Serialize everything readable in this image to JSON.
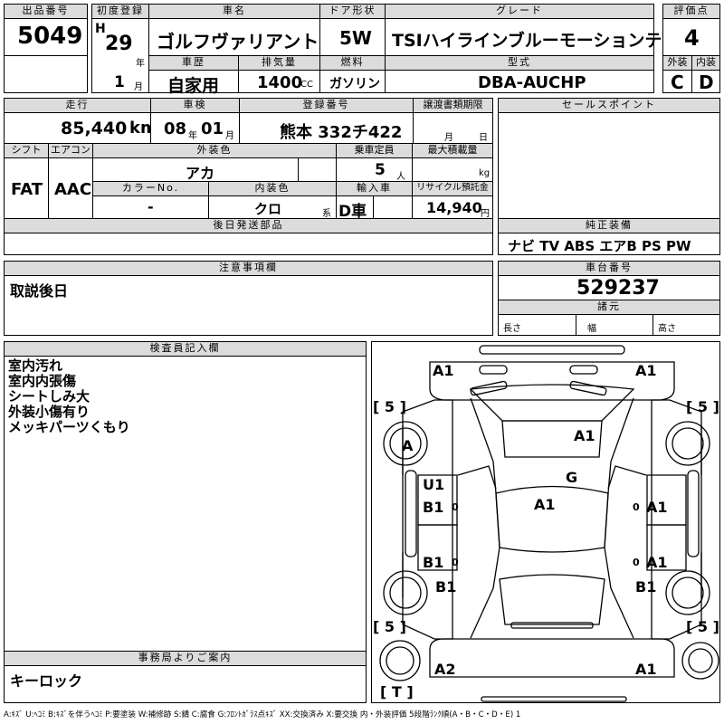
{
  "labels": {
    "lot_no": "出品番号",
    "first_reg": "初度登録",
    "car_name": "車名",
    "door": "ドア形状",
    "grade": "グレード",
    "score": "評価点",
    "history": "車歴",
    "displacement": "排気量",
    "fuel": "燃料",
    "model": "型式",
    "exterior": "外装",
    "interior": "内装",
    "mileage": "走行",
    "inspection": "車検",
    "reg_no": "登録番号",
    "transfer_deadline": "譲渡書類期限",
    "sales_points": "セールスポイント",
    "shift": "シフト",
    "aircon": "エアコン",
    "ext_color": "外装色",
    "capacity": "乗車定員",
    "max_load": "最大積載量",
    "color_no": "カラーNo.",
    "int_color": "内装色",
    "import": "輸入車",
    "recycle": "リサイクル預託金",
    "later_parts": "後日発送部品",
    "genuine": "純正装備",
    "notes": "注意事項欄",
    "chassis": "車台番号",
    "specs": "諸元",
    "length": "長さ",
    "width": "幅",
    "height": "高さ",
    "inspector": "検査員記入欄",
    "office": "事務局よりご案内",
    "era_h": "H",
    "unit_year": "年",
    "unit_month": "月",
    "unit_cc": "CC",
    "unit_km": "km",
    "unit_people": "人",
    "unit_kg": "kg",
    "unit_yen": "円",
    "unit_kei": "系"
  },
  "values": {
    "lot_no": "5049",
    "year": "29",
    "car_name": "ゴルフヴァリアント",
    "door": "5W",
    "grade": "TSIハイラインブルーモーションテクノ",
    "score": "4",
    "month": "1",
    "history": "自家用",
    "displacement": "1400",
    "fuel": "ガソリン",
    "model": "DBA-AUCHP",
    "exterior": "C",
    "interior": "D",
    "mileage": "85,440",
    "insp_year": "08",
    "insp_month": "01",
    "reg_no": "熊本 332チ422",
    "shift": "FAT",
    "aircon": "AAC",
    "ext_color": "アカ",
    "capacity": "5",
    "color_no": "-",
    "int_color": "クロ",
    "import": "D車",
    "recycle": "14,940",
    "genuine": "ナビ TV ABS エアB PS PW",
    "notes": "取説後日",
    "chassis": "529237",
    "office_note": "キーロック"
  },
  "inspector_notes": [
    "室内汚れ",
    "室内内張傷",
    "シートしみ大",
    "外装小傷有り",
    "メッキパーツくもり"
  ],
  "diagram_marks": {
    "front_left": "A1",
    "front_right": "A1",
    "hood": "A1",
    "windshield": "G",
    "roof": "A1",
    "left_front_wheel": "A",
    "left_front_door_u": "U1",
    "left_front_door": "B1",
    "left_rear_door": "B1",
    "left_rear_wheel": "B1",
    "right_front_door": "A1",
    "right_rear_door": "A1",
    "right_rear_wheel": "B1",
    "rear_left": "A2",
    "rear_right": "A1",
    "tire_fl": "[ 5 ]",
    "tire_fr": "[ 5 ]",
    "tire_rl": "[ 5 ]",
    "tire_rr": "[ 5 ]",
    "spare": "[ T ]",
    "lf0": "0",
    "lr0": "0",
    "rf0": "0",
    "rr0": "0"
  },
  "legend": "A:ｷｽﾞ U:ﾍｺﾐ B:ｷｽﾞを伴うﾍｺﾐ P:要塗装 W:補修跡 S:錆 C:腐食 G:ﾌﾛﾝﾄｶﾞﾗｽ点ｷｽﾞ XX:交換済み X:要交換 内・外装評価 5段階ﾗﾝｸ順(A・B・C・D・E) 1"
}
